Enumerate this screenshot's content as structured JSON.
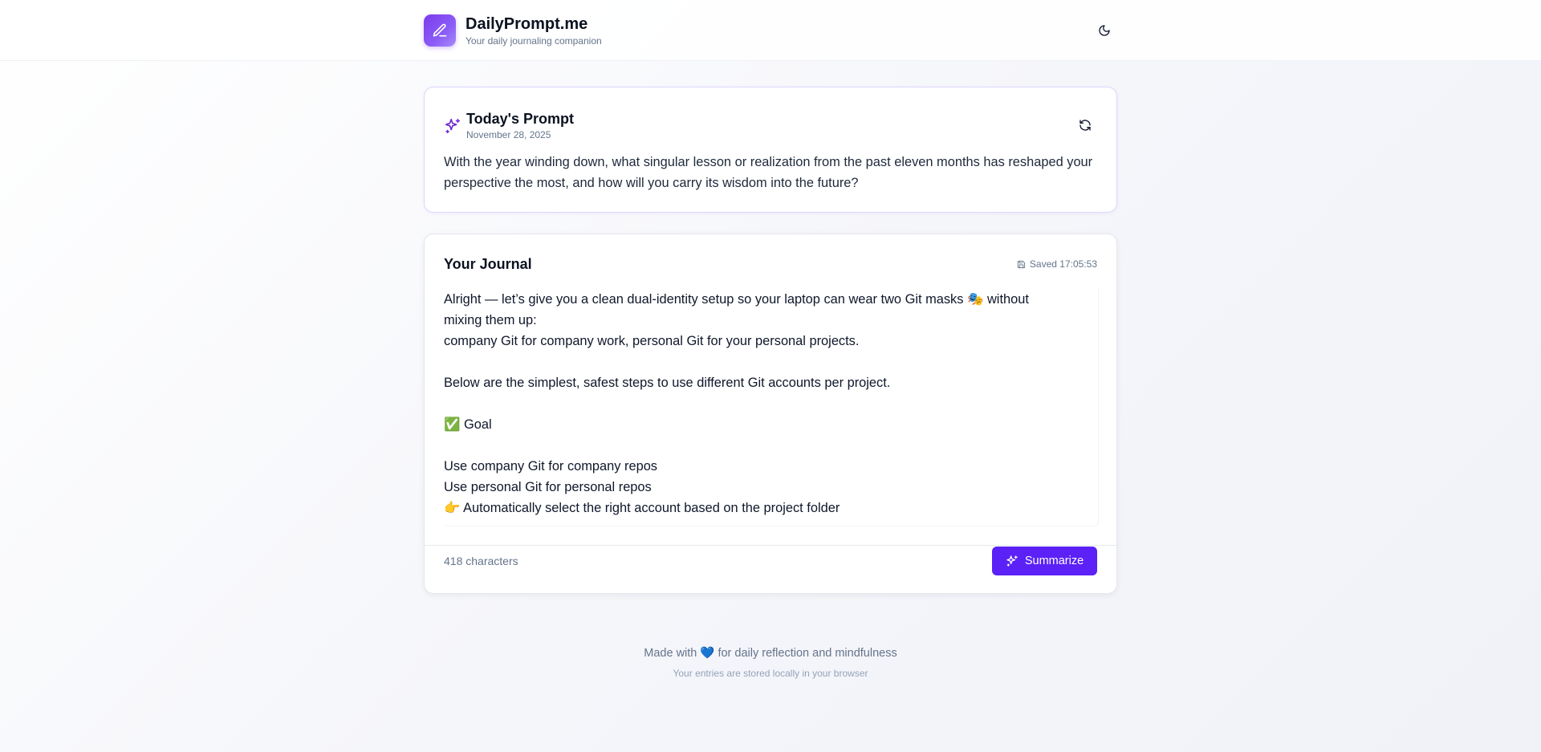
{
  "header": {
    "title": "DailyPrompt.me",
    "subtitle": "Your daily journaling companion",
    "logo_icon": "pencil-icon",
    "theme_icon": "moon-icon"
  },
  "prompt": {
    "title": "Today's Prompt",
    "date": "November 28, 2025",
    "text": "With the year winding down, what singular lesson or realization from the past eleven months has reshaped your perspective the most, and how will you carry its wisdom into the future?",
    "icon": "sparkles-icon",
    "refresh_icon": "refresh-icon"
  },
  "journal": {
    "title": "Your Journal",
    "saved_label": "Saved 17:05:53",
    "lines": [
      "Alright — let’s give you a clean dual-identity setup so your laptop can wear two Git masks 🎭 without",
      "mixing them up:",
      "company Git for company work, personal Git for your personal projects.",
      "",
      "Below are the simplest, safest steps to use different Git accounts per project.",
      "",
      "✅ Goal",
      "",
      "Use company Git for company repos",
      "Use personal Git for personal repos",
      "👉 Automatically select the right account based on the project folder"
    ],
    "char_count": "418 characters",
    "summarize_label": "Summarize"
  },
  "footer": {
    "main": "Made with 💙 for daily reflection and mindfulness",
    "sub": "Your entries are stored locally in your browser"
  },
  "colors": {
    "accent": "#5b21f6",
    "logo_gradient_start": "#7c3aed",
    "logo_gradient_end": "#a78bfa",
    "prompt_border": "#ddd6fe"
  }
}
